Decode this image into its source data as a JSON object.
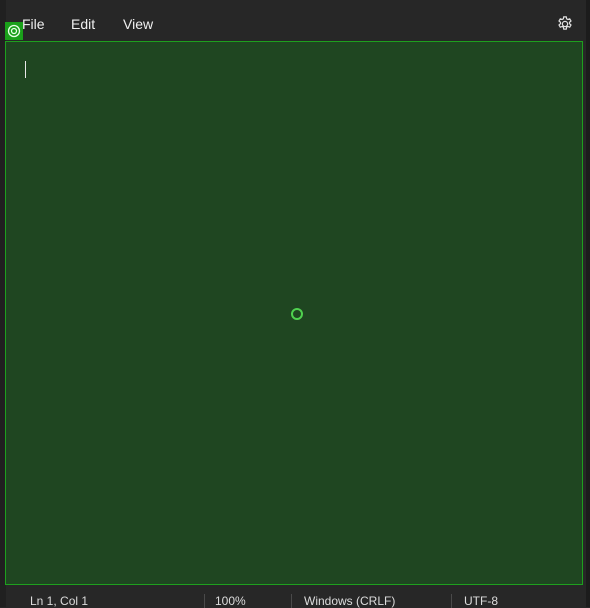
{
  "menu": {
    "file": "File",
    "edit": "Edit",
    "view": "View"
  },
  "editor": {
    "content": ""
  },
  "status": {
    "position": "Ln 1, Col 1",
    "zoom": "100%",
    "line_ending": "Windows (CRLF)",
    "encoding": "UTF-8"
  },
  "colors": {
    "editor_bg": "#1f4621",
    "accent": "#1ea01e"
  },
  "icons": {
    "settings": "gear-icon",
    "badge": "target-icon"
  }
}
